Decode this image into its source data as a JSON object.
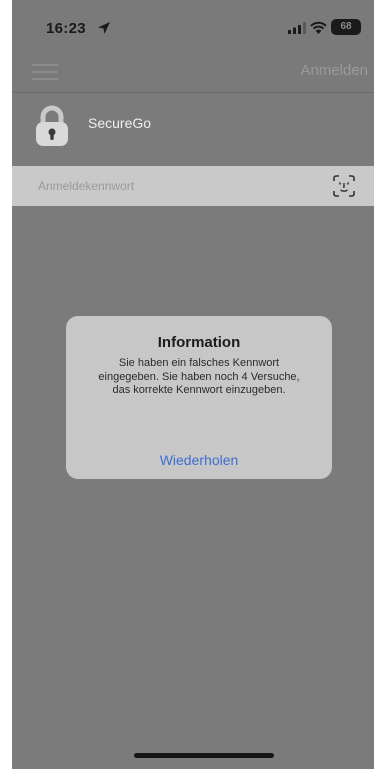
{
  "status_bar": {
    "time": "16:23",
    "battery": "68",
    "icons": [
      "location-arrow-icon",
      "signal-icon",
      "wifi-icon",
      "battery-icon"
    ]
  },
  "nav": {
    "menu_icon": "hamburger-menu-icon",
    "action_label": "Anmelden"
  },
  "app": {
    "icon": "padlock-icon",
    "name": "SecureGo"
  },
  "password": {
    "placeholder": "Anmeldekennwort",
    "value": "",
    "icon": "face-id-icon"
  },
  "dialog": {
    "title": "Information",
    "message": "Sie haben ein falsches Kennwort eingegeben. Sie haben noch 4 Versuche, das korrekte Kennwort einzugeben.",
    "button_label": "Wiederholen",
    "button_color": "#3c6fd1"
  },
  "colors": {
    "overlay": "#7b7b7b",
    "dialog_bg": "#c7c7c7",
    "input_bg": "#c9c9c9"
  }
}
